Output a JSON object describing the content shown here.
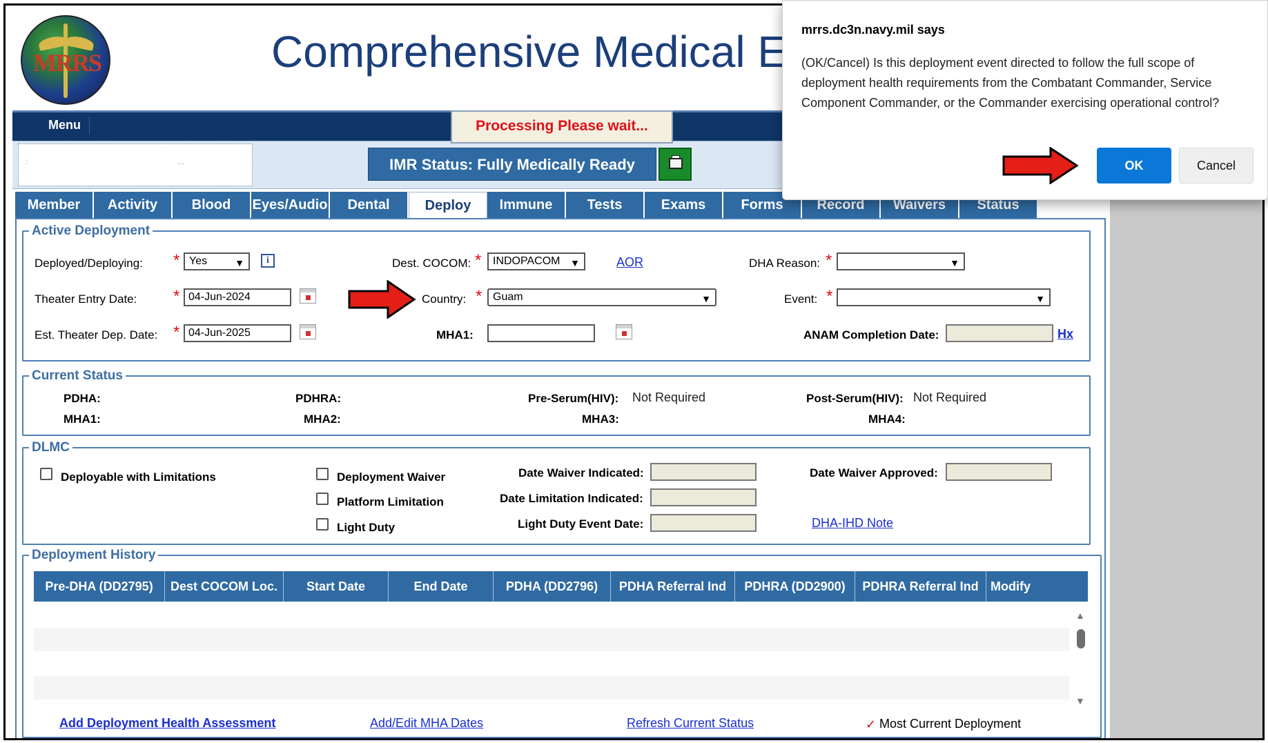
{
  "app": {
    "logo_text": "MRRS",
    "title": "Comprehensive Medical En",
    "menu_label": "Menu",
    "processing_text": "Processing Please wait...",
    "imr_status": "IMR Status: Fully Medically Ready"
  },
  "tabs": [
    {
      "label": "Member"
    },
    {
      "label": "Activity"
    },
    {
      "label": "Blood"
    },
    {
      "label": "Eyes/Audio"
    },
    {
      "label": "Dental"
    },
    {
      "label": "Deploy"
    },
    {
      "label": "Immune"
    },
    {
      "label": "Tests"
    },
    {
      "label": "Exams"
    },
    {
      "label": "Forms"
    },
    {
      "label": "Record"
    },
    {
      "label": "Waivers"
    },
    {
      "label": "Status"
    }
  ],
  "active_deployment": {
    "legend": "Active Deployment",
    "deployed_label": "Deployed/Deploying:",
    "deployed_value": "Yes",
    "dest_cocom_label": "Dest. COCOM:",
    "dest_cocom_value": "INDOPACOM",
    "aor_link": "AOR",
    "dha_reason_label": "DHA Reason:",
    "dha_reason_value": "",
    "theater_entry_label": "Theater Entry Date:",
    "theater_entry_value": "04-Jun-2024",
    "country_label": "Country:",
    "country_value": "Guam",
    "event_label": "Event:",
    "event_value": "",
    "est_dep_label": "Est. Theater Dep. Date:",
    "est_dep_value": "04-Jun-2025",
    "mha1_label": "MHA1:",
    "mha1_value": "",
    "anam_label": "ANAM Completion Date:",
    "anam_value": "",
    "hx_link": "Hx"
  },
  "current_status": {
    "legend": "Current Status",
    "pdha_label": "PDHA:",
    "pdhra_label": "PDHRA:",
    "pre_serum_label": "Pre-Serum(HIV):",
    "pre_serum_value": "Not Required",
    "post_serum_label": "Post-Serum(HIV):",
    "post_serum_value": "Not Required",
    "mha1_label": "MHA1:",
    "mha2_label": "MHA2:",
    "mha3_label": "MHA3:",
    "mha4_label": "MHA4:"
  },
  "dlmc": {
    "legend": "DLMC",
    "deployable_limitations": "Deployable with Limitations",
    "deployment_waiver": "Deployment Waiver",
    "platform_limitation": "Platform Limitation",
    "light_duty": "Light Duty",
    "date_waiver_indicated": "Date Waiver Indicated:",
    "date_limitation_indicated": "Date Limitation Indicated:",
    "light_duty_event_date": "Light Duty Event Date:",
    "date_waiver_approved": "Date Waiver Approved:",
    "dha_ihd_note": "DHA-IHD Note"
  },
  "history": {
    "legend": "Deployment History",
    "columns": [
      "Pre-DHA (DD2795)",
      "Dest COCOM Loc.",
      "Start Date",
      "End Date",
      "PDHA (DD2796)",
      "PDHA Referral Ind",
      "PDHRA (DD2900)",
      "PDHRA Referral Ind",
      "Modify"
    ],
    "add_dha_link": "Add Deployment Health Assessment",
    "add_mha_link": "Add/Edit MHA Dates",
    "refresh_link": "Refresh Current Status",
    "check_mark": "✓",
    "most_current": "Most Current Deployment"
  },
  "dialog": {
    "title": "mrrs.dc3n.navy.mil says",
    "message": "(OK/Cancel) Is this deployment event directed to follow the full scope of deployment health requirements from the Combatant Commander, Service Component Commander, or the Commander exercising operational control?",
    "ok_label": "OK",
    "cancel_label": "Cancel"
  },
  "colors": {
    "navy": "#0f3666",
    "tab_blue": "#2f6aa2",
    "required_red": "#e0101a",
    "ok_blue": "#0b78d7"
  }
}
